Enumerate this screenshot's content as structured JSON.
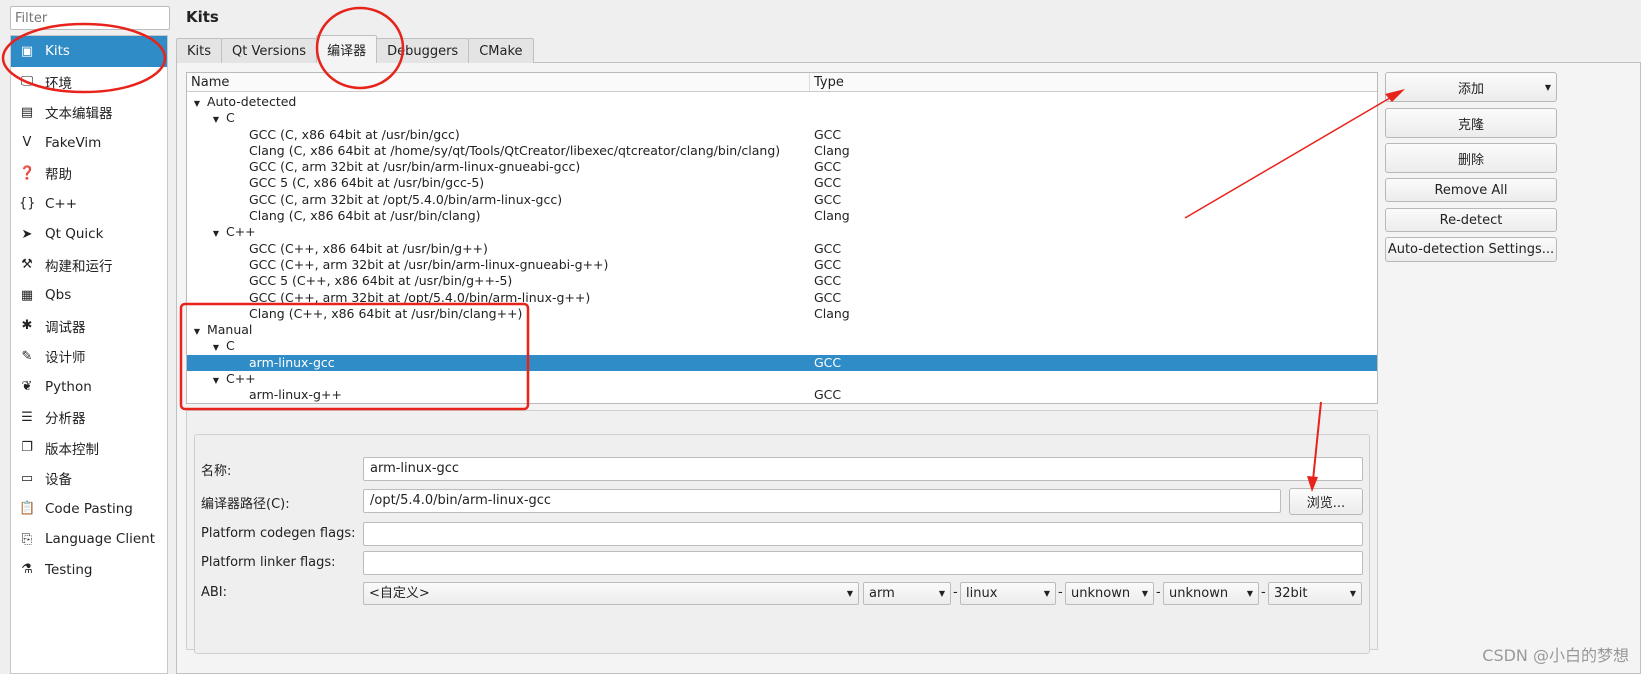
{
  "filter": {
    "placeholder": "Filter"
  },
  "sidebar": {
    "items": [
      {
        "label": "Kits",
        "icon": "kits-icon",
        "glyph": "▣",
        "selected": true
      },
      {
        "label": "环境",
        "icon": "monitor-icon",
        "glyph": "🖵"
      },
      {
        "label": "文本编辑器",
        "icon": "text-editor-icon",
        "glyph": "▤"
      },
      {
        "label": "FakeVim",
        "icon": "fakevim-icon",
        "glyph": "V"
      },
      {
        "label": "帮助",
        "icon": "help-icon",
        "glyph": "❓"
      },
      {
        "label": "C++",
        "icon": "braces-icon",
        "glyph": "{}"
      },
      {
        "label": "Qt Quick",
        "icon": "paper-plane-icon",
        "glyph": "➤"
      },
      {
        "label": "构建和运行",
        "icon": "hammer-icon",
        "glyph": "⚒"
      },
      {
        "label": "Qbs",
        "icon": "qbs-icon",
        "glyph": "▦"
      },
      {
        "label": "调试器",
        "icon": "bug-icon",
        "glyph": "✱"
      },
      {
        "label": "设计师",
        "icon": "pen-icon",
        "glyph": "✎"
      },
      {
        "label": "Python",
        "icon": "python-icon",
        "glyph": "❦"
      },
      {
        "label": "分析器",
        "icon": "analyzer-icon",
        "glyph": "☰"
      },
      {
        "label": "版本控制",
        "icon": "version-control-icon",
        "glyph": "❐"
      },
      {
        "label": "设备",
        "icon": "device-icon",
        "glyph": "▭"
      },
      {
        "label": "Code Pasting",
        "icon": "paste-icon",
        "glyph": "📋"
      },
      {
        "label": "Language Client",
        "icon": "language-client-icon",
        "glyph": "⎘"
      },
      {
        "label": "Testing",
        "icon": "testing-icon",
        "glyph": "⚗"
      }
    ]
  },
  "header": {
    "title": "Kits"
  },
  "tabs": [
    {
      "label": "Kits"
    },
    {
      "label": "Qt Versions"
    },
    {
      "label": "编译器",
      "active": true
    },
    {
      "label": "Debuggers"
    },
    {
      "label": "CMake"
    }
  ],
  "tree": {
    "columns": [
      "Name",
      "Type"
    ],
    "rows": [
      {
        "name": "Auto-detected",
        "type": "",
        "level": 0,
        "expander": true
      },
      {
        "name": "C",
        "type": "",
        "level": 1,
        "expander": true
      },
      {
        "name": "GCC (C, x86 64bit at /usr/bin/gcc)",
        "type": "GCC",
        "level": 2
      },
      {
        "name": "Clang (C, x86 64bit at /home/sy/qt/Tools/QtCreator/libexec/qtcreator/clang/bin/clang)",
        "type": "Clang",
        "level": 2
      },
      {
        "name": "GCC (C, arm 32bit at /usr/bin/arm-linux-gnueabi-gcc)",
        "type": "GCC",
        "level": 2
      },
      {
        "name": "GCC 5 (C, x86 64bit at /usr/bin/gcc-5)",
        "type": "GCC",
        "level": 2
      },
      {
        "name": "GCC (C, arm 32bit at /opt/5.4.0/bin/arm-linux-gcc)",
        "type": "GCC",
        "level": 2
      },
      {
        "name": "Clang (C, x86 64bit at /usr/bin/clang)",
        "type": "Clang",
        "level": 2
      },
      {
        "name": "C++",
        "type": "",
        "level": 1,
        "expander": true
      },
      {
        "name": "GCC (C++, x86 64bit at /usr/bin/g++)",
        "type": "GCC",
        "level": 2
      },
      {
        "name": "GCC (C++, arm 32bit at /usr/bin/arm-linux-gnueabi-g++)",
        "type": "GCC",
        "level": 2
      },
      {
        "name": "GCC 5 (C++, x86 64bit at /usr/bin/g++-5)",
        "type": "GCC",
        "level": 2
      },
      {
        "name": "GCC (C++, arm 32bit at /opt/5.4.0/bin/arm-linux-g++)",
        "type": "GCC",
        "level": 2
      },
      {
        "name": "Clang (C++, x86 64bit at /usr/bin/clang++)",
        "type": "Clang",
        "level": 2
      },
      {
        "name": "Manual",
        "type": "",
        "level": 0,
        "expander": true
      },
      {
        "name": "C",
        "type": "",
        "level": 1,
        "expander": true
      },
      {
        "name": "arm-linux-gcc",
        "type": "GCC",
        "level": 2,
        "selected": true
      },
      {
        "name": "C++",
        "type": "",
        "level": 1,
        "expander": true
      },
      {
        "name": "arm-linux-g++",
        "type": "GCC",
        "level": 2
      }
    ]
  },
  "buttons": {
    "add": "添加",
    "clone": "克隆",
    "remove": "删除",
    "remove_all": "Remove All",
    "redetect": "Re-detect",
    "auto_settings": "Auto-detection Settings..."
  },
  "form": {
    "name_label": "名称:",
    "name_value": "arm-linux-gcc",
    "path_label": "编译器路径(C):",
    "path_value": "/opt/5.4.0/bin/arm-linux-gcc",
    "browse": "浏览...",
    "codegen_label": "Platform codegen flags:",
    "codegen_value": "",
    "linker_label": "Platform linker flags:",
    "linker_value": "",
    "abi_label": "ABI:",
    "abi": [
      "<自定义>",
      "arm",
      "linux",
      "unknown",
      "unknown",
      "32bit"
    ],
    "sep": "-"
  },
  "watermark": "CSDN @小白的梦想",
  "colors": {
    "selection": "#308cc6",
    "annotation": "#e8231b"
  }
}
